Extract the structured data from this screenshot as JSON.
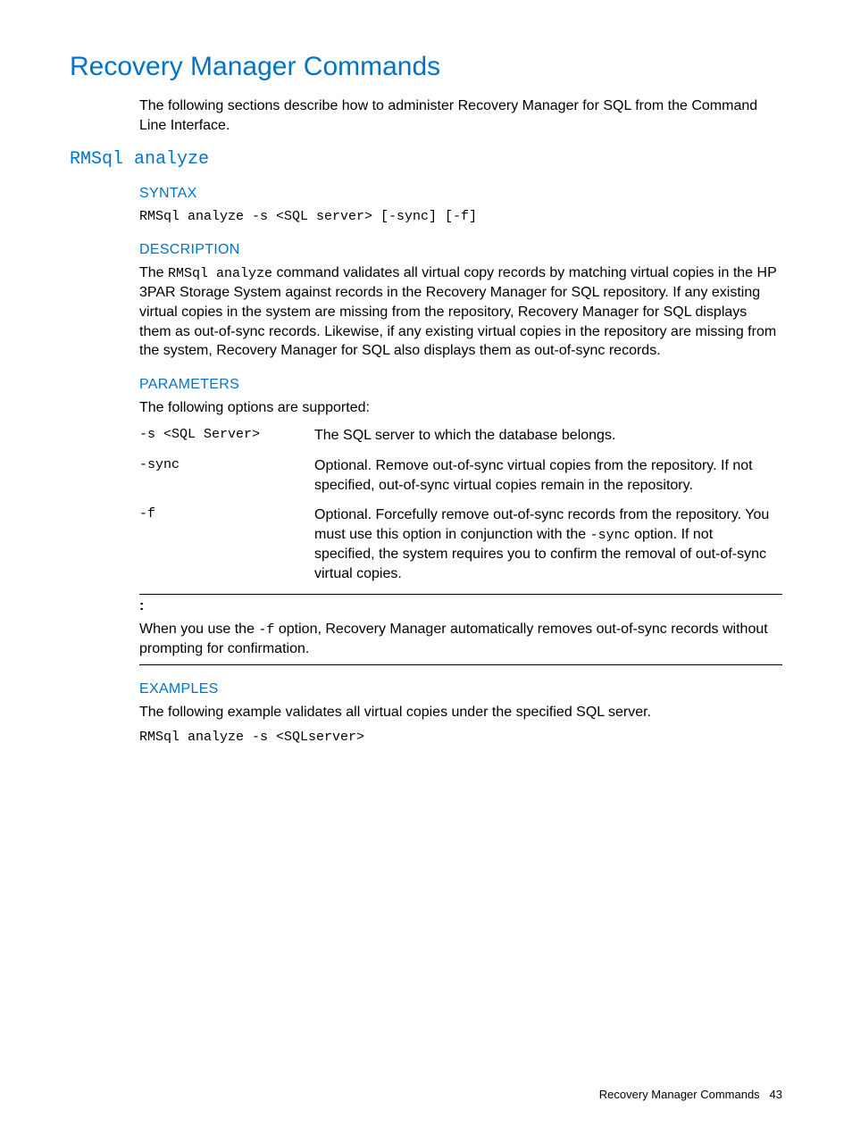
{
  "page": {
    "title": "Recovery Manager Commands",
    "intro": "The following sections describe how to administer Recovery Manager for SQL from the Command Line Interface.",
    "footer_label": "Recovery Manager Commands",
    "footer_page": "43"
  },
  "command": {
    "name": "RMSql analyze",
    "syntax": {
      "heading": "SYNTAX",
      "text": "RMSql analyze -s <SQL server> [-sync] [-f]"
    },
    "description": {
      "heading": "DESCRIPTION",
      "pre": "The ",
      "cmd": "RMSql analyze",
      "post": " command validates all virtual copy records by matching virtual copies in the HP 3PAR Storage System against records in the Recovery Manager for SQL repository. If any existing virtual copies in the system are missing from the repository, Recovery Manager for SQL displays them as out-of-sync records. Likewise, if any existing virtual copies in the repository are missing from the system, Recovery Manager for SQL also displays them as out-of-sync records."
    },
    "parameters": {
      "heading": "PARAMETERS",
      "intro": "The following options are supported:",
      "rows": [
        {
          "opt": "-s <SQL Server>",
          "desc": "The SQL server to which the database belongs."
        },
        {
          "opt": "-sync",
          "desc": "Optional. Remove out-of-sync virtual copies from the repository. If not specified, out-of-sync virtual copies remain in the repository."
        },
        {
          "opt": "-f",
          "desc_pre": "Optional. Forcefully remove out-of-sync records from the repository. You must use this option in conjunction with the ",
          "desc_code": "-sync",
          "desc_post": " option. If not specified, the system requires you to confirm the removal of out-of-sync virtual copies."
        }
      ]
    },
    "note": {
      "colon": ":",
      "pre": "When you use the ",
      "code": "-f",
      "post": " option, Recovery Manager automatically removes out-of-sync records without prompting for confirmation."
    },
    "examples": {
      "heading": "EXAMPLES",
      "intro": "The following example validates all virtual copies under the specified SQL server.",
      "code": "RMSql analyze -s <SQLserver>"
    }
  }
}
